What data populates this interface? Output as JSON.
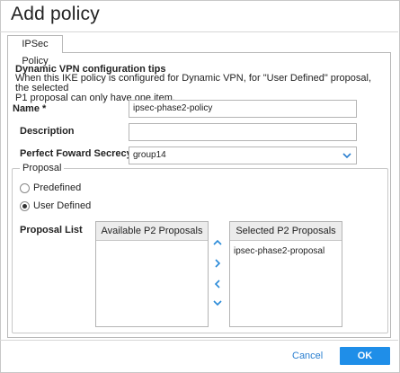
{
  "dialog": {
    "title": "Add policy",
    "tabs": [
      {
        "label": "IPSec Policy",
        "active": true
      }
    ]
  },
  "tips": {
    "title": "Dynamic VPN configuration tips",
    "line1": "When this IKE policy is configured for Dynamic VPN, for \"User Defined\" proposal, the selected",
    "line2": "P1 proposal can only have one item."
  },
  "form": {
    "name_label": "Name *",
    "name_value": "ipsec-phase2-policy",
    "description_label": "Description",
    "description_value": "",
    "pfs_label": "Perfect Foward Secrecy",
    "pfs_value": "group14"
  },
  "proposal": {
    "legend": "Proposal",
    "predefined_label": "Predefined",
    "user_defined_label": "User Defined",
    "selected_option": "User Defined",
    "list_label": "Proposal List",
    "available_header": "Available P2 Proposals",
    "available_items": [],
    "selected_header": "Selected P2 Proposals",
    "selected_items": [
      "ipsec-phase2-proposal"
    ]
  },
  "footer": {
    "cancel_label": "Cancel",
    "ok_label": "OK"
  },
  "colors": {
    "accent": "#1f8ee8",
    "link": "#2a7fd0",
    "border": "#b4b4b4"
  },
  "icons": {
    "pfs_select": "chevron-down-icon",
    "move_up": "chevron-up-icon",
    "move_right": "chevron-right-icon",
    "move_left": "chevron-left-icon",
    "move_down": "chevron-down-icon"
  }
}
